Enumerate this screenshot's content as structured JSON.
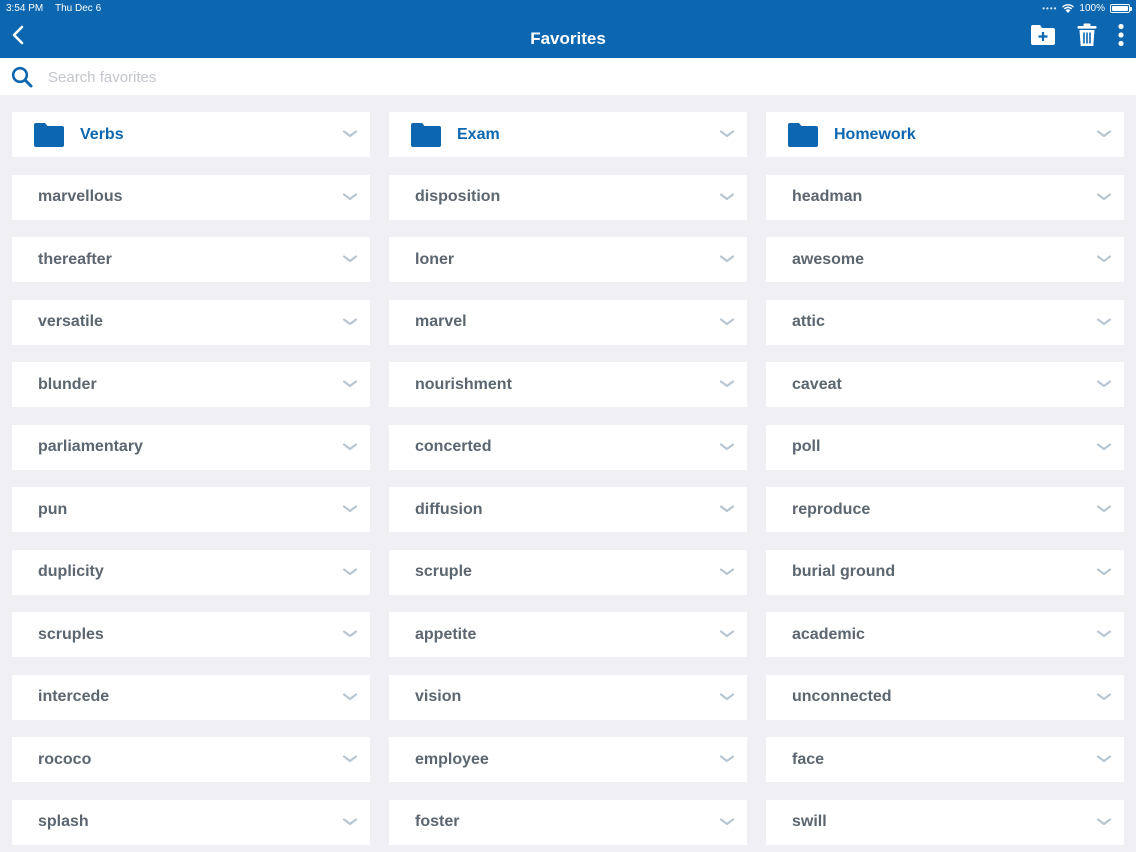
{
  "status_bar": {
    "time": "3:54 PM",
    "date": "Thu Dec 6",
    "battery": "100%"
  },
  "header": {
    "title": "Favorites"
  },
  "search": {
    "placeholder": "Search favorites",
    "value": ""
  },
  "colors": {
    "brand": "#0d67b0",
    "background": "#efeff4",
    "word_text": "#5b6670",
    "chevron": "#b8c6d2"
  },
  "icons": [
    "back-chevron-icon",
    "new-folder-icon",
    "trash-icon",
    "more-vertical-icon",
    "search-icon",
    "folder-icon",
    "chevron-down-icon"
  ],
  "columns": [
    {
      "folder": "Verbs",
      "words": [
        "marvellous",
        "thereafter",
        "versatile",
        "blunder",
        "parliamentary",
        "pun",
        "duplicity",
        "scruples",
        "intercede",
        "rococo",
        "splash"
      ]
    },
    {
      "folder": "Exam",
      "words": [
        "disposition",
        "loner",
        "marvel",
        "nourishment",
        "concerted",
        "diffusion",
        "scruple",
        "appetite",
        "vision",
        "employee",
        "foster"
      ]
    },
    {
      "folder": "Homework",
      "words": [
        "headman",
        "awesome",
        "attic",
        "caveat",
        "poll",
        "reproduce",
        "burial ground",
        "academic",
        "unconnected",
        "face",
        "swill"
      ]
    }
  ]
}
